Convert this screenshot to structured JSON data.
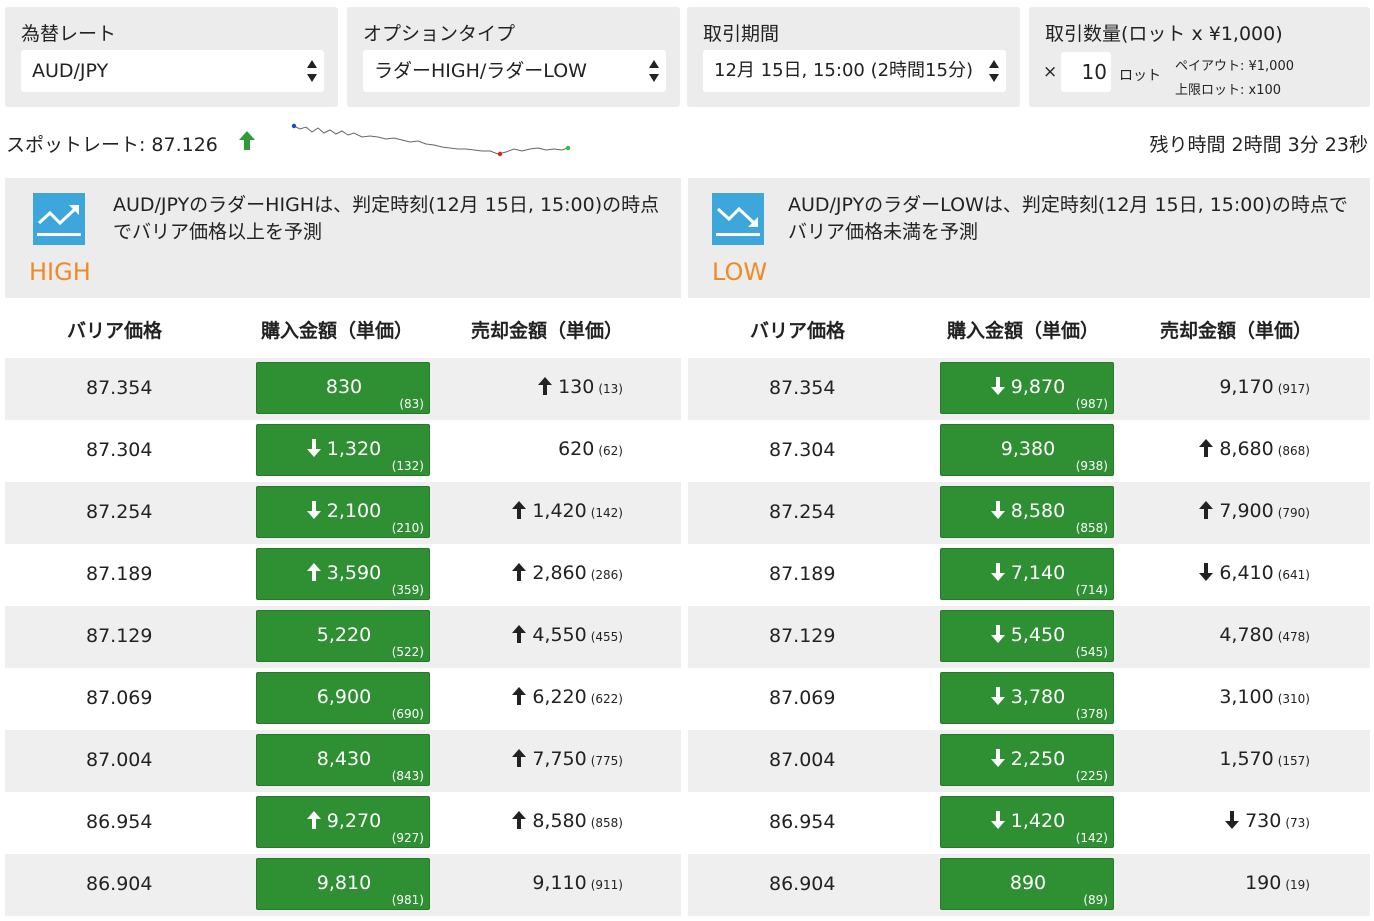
{
  "controls": {
    "currency": {
      "label": "為替レート",
      "value": "AUD/JPY"
    },
    "option_type": {
      "label": "オプションタイプ",
      "value": "ラダーHIGH/ラダーLOW"
    },
    "period": {
      "label": "取引期間",
      "value": "12月 15日, 15:00 (2時間15分)"
    },
    "quantity": {
      "label": "取引数量(ロット x ¥1,000)",
      "multiplier": "×",
      "value": "10",
      "unit": "ロット",
      "payout": "ペイアウト: ¥1,000",
      "max_lot": "上限ロット: x100"
    }
  },
  "spot": {
    "label": "スポットレート:",
    "value": "87.126",
    "direction": "up",
    "up_color": "#2e9b34"
  },
  "remaining": "残り時間 2時間 3分 23秒",
  "high_panel": {
    "description": "AUD/JPYのラダーHIGHは、判定時刻(12月 15日, 15:00)の時点でバリア価格以上を予測",
    "kind": "HIGH"
  },
  "low_panel": {
    "description": "AUD/JPYのラダーLOWは、判定時刻(12月 15日, 15:00)の時点でバリア価格未満を予測",
    "kind": "LOW"
  },
  "table_headers": {
    "barrier": "バリア価格",
    "buy": "購入金額（単価）",
    "sell": "売却金額（単価）"
  },
  "high_rows": [
    {
      "barrier": "87.354",
      "buy": "830",
      "buy_unit": "(83)",
      "buy_arrow": "",
      "sell": "130",
      "sell_unit": "(13)",
      "sell_arrow": "up"
    },
    {
      "barrier": "87.304",
      "buy": "1,320",
      "buy_unit": "(132)",
      "buy_arrow": "down",
      "sell": "620",
      "sell_unit": "(62)",
      "sell_arrow": ""
    },
    {
      "barrier": "87.254",
      "buy": "2,100",
      "buy_unit": "(210)",
      "buy_arrow": "down",
      "sell": "1,420",
      "sell_unit": "(142)",
      "sell_arrow": "up"
    },
    {
      "barrier": "87.189",
      "buy": "3,590",
      "buy_unit": "(359)",
      "buy_arrow": "up",
      "sell": "2,860",
      "sell_unit": "(286)",
      "sell_arrow": "up"
    },
    {
      "barrier": "87.129",
      "buy": "5,220",
      "buy_unit": "(522)",
      "buy_arrow": "",
      "sell": "4,550",
      "sell_unit": "(455)",
      "sell_arrow": "up"
    },
    {
      "barrier": "87.069",
      "buy": "6,900",
      "buy_unit": "(690)",
      "buy_arrow": "",
      "sell": "6,220",
      "sell_unit": "(622)",
      "sell_arrow": "up"
    },
    {
      "barrier": "87.004",
      "buy": "8,430",
      "buy_unit": "(843)",
      "buy_arrow": "",
      "sell": "7,750",
      "sell_unit": "(775)",
      "sell_arrow": "up"
    },
    {
      "barrier": "86.954",
      "buy": "9,270",
      "buy_unit": "(927)",
      "buy_arrow": "up",
      "sell": "8,580",
      "sell_unit": "(858)",
      "sell_arrow": "up"
    },
    {
      "barrier": "86.904",
      "buy": "9,810",
      "buy_unit": "(981)",
      "buy_arrow": "",
      "sell": "9,110",
      "sell_unit": "(911)",
      "sell_arrow": ""
    }
  ],
  "low_rows": [
    {
      "barrier": "87.354",
      "buy": "9,870",
      "buy_unit": "(987)",
      "buy_arrow": "down",
      "sell": "9,170",
      "sell_unit": "(917)",
      "sell_arrow": ""
    },
    {
      "barrier": "87.304",
      "buy": "9,380",
      "buy_unit": "(938)",
      "buy_arrow": "",
      "sell": "8,680",
      "sell_unit": "(868)",
      "sell_arrow": "up"
    },
    {
      "barrier": "87.254",
      "buy": "8,580",
      "buy_unit": "(858)",
      "buy_arrow": "down",
      "sell": "7,900",
      "sell_unit": "(790)",
      "sell_arrow": "up"
    },
    {
      "barrier": "87.189",
      "buy": "7,140",
      "buy_unit": "(714)",
      "buy_arrow": "down",
      "sell": "6,410",
      "sell_unit": "(641)",
      "sell_arrow": "down"
    },
    {
      "barrier": "87.129",
      "buy": "5,450",
      "buy_unit": "(545)",
      "buy_arrow": "down",
      "sell": "4,780",
      "sell_unit": "(478)",
      "sell_arrow": ""
    },
    {
      "barrier": "87.069",
      "buy": "3,780",
      "buy_unit": "(378)",
      "buy_arrow": "down",
      "sell": "3,100",
      "sell_unit": "(310)",
      "sell_arrow": ""
    },
    {
      "barrier": "87.004",
      "buy": "2,250",
      "buy_unit": "(225)",
      "buy_arrow": "down",
      "sell": "1,570",
      "sell_unit": "(157)",
      "sell_arrow": ""
    },
    {
      "barrier": "86.954",
      "buy": "1,420",
      "buy_unit": "(142)",
      "buy_arrow": "down",
      "sell": "730",
      "sell_unit": "(73)",
      "sell_arrow": "down"
    },
    {
      "barrier": "86.904",
      "buy": "890",
      "buy_unit": "(89)",
      "buy_arrow": "",
      "sell": "190",
      "sell_unit": "(19)",
      "sell_arrow": ""
    }
  ]
}
